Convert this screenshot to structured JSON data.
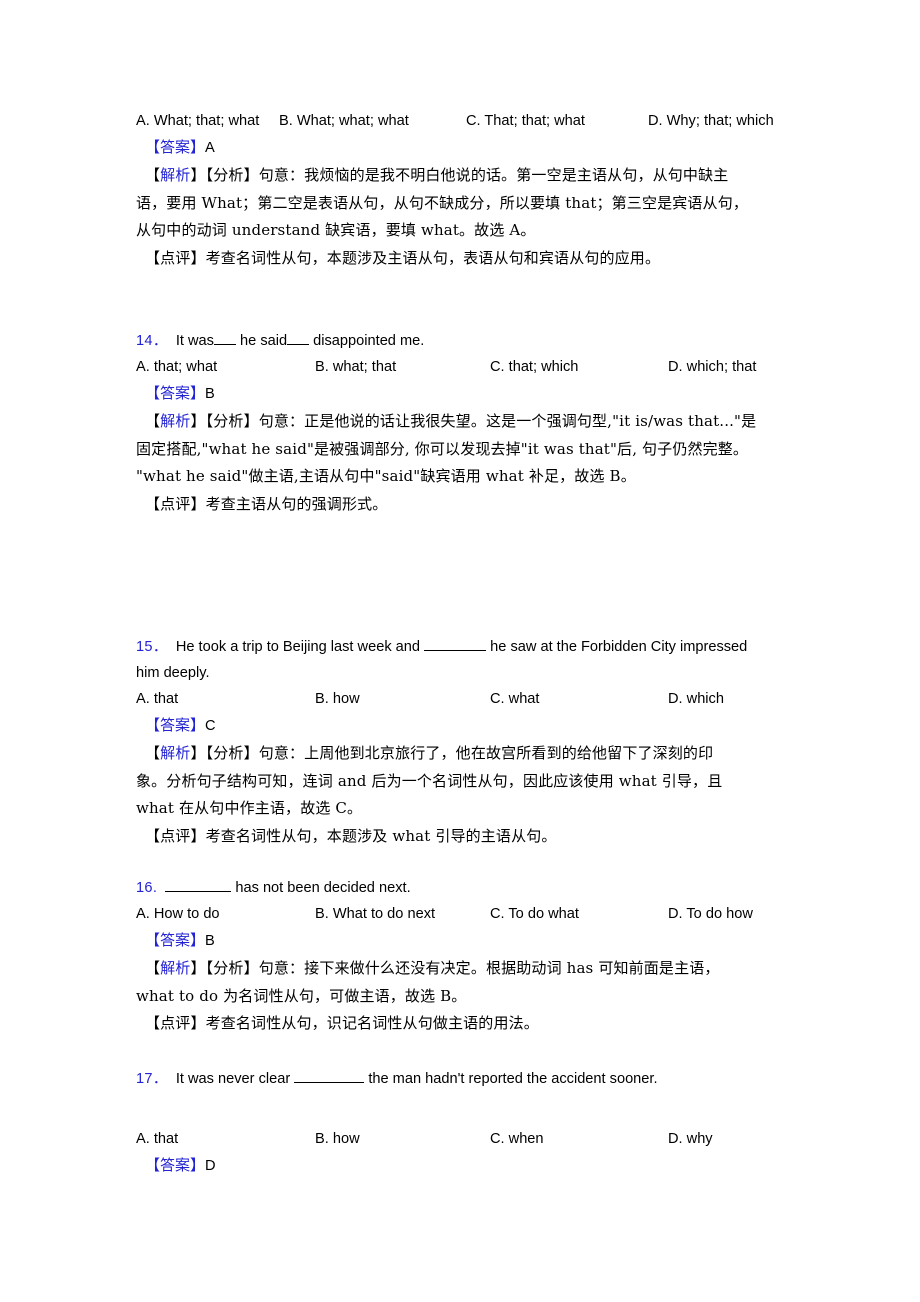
{
  "document": {
    "type": "english-grammar-exercise-answer-key",
    "labels": {
      "answer": "【答案】",
      "analysis_tag": "【解析】",
      "analysis_inner": "【分析】",
      "comment": "【点评】"
    },
    "colors": {
      "accent_blue": "#2323d4",
      "text_black": "#000000",
      "page_background": "#ffffff"
    }
  },
  "questions": [
    {
      "id": "q13",
      "number": "",
      "stem_visible": false,
      "options": [
        "A. What; that; what",
        "B. What; what; what",
        "C. That; that; what",
        "D. Why; that; which"
      ],
      "answer_marker": "【答案】",
      "answer": "A",
      "analysis_marker_open": "【",
      "analysis_marker_word": "解析",
      "analysis_marker_close": "】",
      "analysis_inner": "【分析】",
      "analysis_lines": [
        "句意：我烦恼的是我不明白他说的话。第一空是主语从句，从句中缺主",
        "语，要用 What；第二空是表语从句，从句不缺成分，所以要填 that；第三空是宾语从句，",
        "从句中的动词 understand 缺宾语，要填 what。故选 A。"
      ],
      "comment_marker": "【点评】",
      "comment": "考查名词性从句，本题涉及主语从句，表语从句和宾语从句的应用。"
    },
    {
      "id": "q14",
      "number": "14．",
      "stem_visible": true,
      "stem_parts": {
        "before_blank1": "It was",
        "between_blanks": "he said",
        "after_blank2": "disappointed me."
      },
      "options": [
        "A. that; what",
        "B. what; that",
        "C. that; which",
        "D. which; that"
      ],
      "answer_marker": "【答案】",
      "answer": "B",
      "analysis_marker_word": "解析",
      "analysis_inner": "【分析】",
      "analysis_lines": [
        "句意：正是他说的话让我很失望。这是一个强调句型,\"it is/was that...\"是",
        "固定搭配,\"what he said\"是被强调部分, 你可以发现去掉\"it was that\"后, 句子仍然完整。",
        "\"what he said\"做主语,主语从句中\"said\"缺宾语用 what 补足，故选 B。"
      ],
      "comment_marker": "【点评】",
      "comment": "考查主语从句的强调形式。"
    },
    {
      "id": "q15",
      "number": "15．",
      "stem_visible": true,
      "stem_parts": {
        "line1_before_blank": "He took a trip to Beijing last week and",
        "line1_after_blank": "he saw at the Forbidden City impressed",
        "line2": "him deeply."
      },
      "options": [
        "A. that",
        "B. how",
        "C. what",
        "D. which"
      ],
      "answer_marker": "【答案】",
      "answer": "C",
      "analysis_marker_word": "解析",
      "analysis_inner": "【分析】",
      "analysis_lines": [
        "句意：上周他到北京旅行了，他在故宫所看到的给他留下了深刻的印",
        "象。分析句子结构可知，连词 and 后为一个名词性从句，因此应该使用 what 引导，且",
        "what 在从句中作主语，故选 C。"
      ],
      "comment_marker": "【点评】",
      "comment": "考查名词性从句，本题涉及 what 引导的主语从句。"
    },
    {
      "id": "q16",
      "number": "16.",
      "stem_visible": true,
      "stem_parts": {
        "after_blank": "has not been decided next."
      },
      "options": [
        "A. How to do",
        "B. What to do next",
        "C. To do what",
        "D. To do how"
      ],
      "answer_marker": "【答案】",
      "answer": "B",
      "analysis_marker_word": "解析",
      "analysis_inner": "【分析】",
      "analysis_lines": [
        "句意：接下来做什么还没有决定。根据助动词 has 可知前面是主语，",
        "what to do 为名词性从句，可做主语，故选 B。"
      ],
      "comment_marker": "【点评】",
      "comment": "考查名词性从句，识记名词性从句做主语的用法。"
    },
    {
      "id": "q17",
      "number": "17．",
      "stem_visible": true,
      "stem_parts": {
        "before_blank": "It was never clear",
        "after_blank": "the man hadn't reported the accident sooner."
      },
      "options": [
        "A. that",
        "B. how",
        "C. when",
        "D. why"
      ],
      "answer_marker": "【答案】",
      "answer": "D"
    }
  ]
}
